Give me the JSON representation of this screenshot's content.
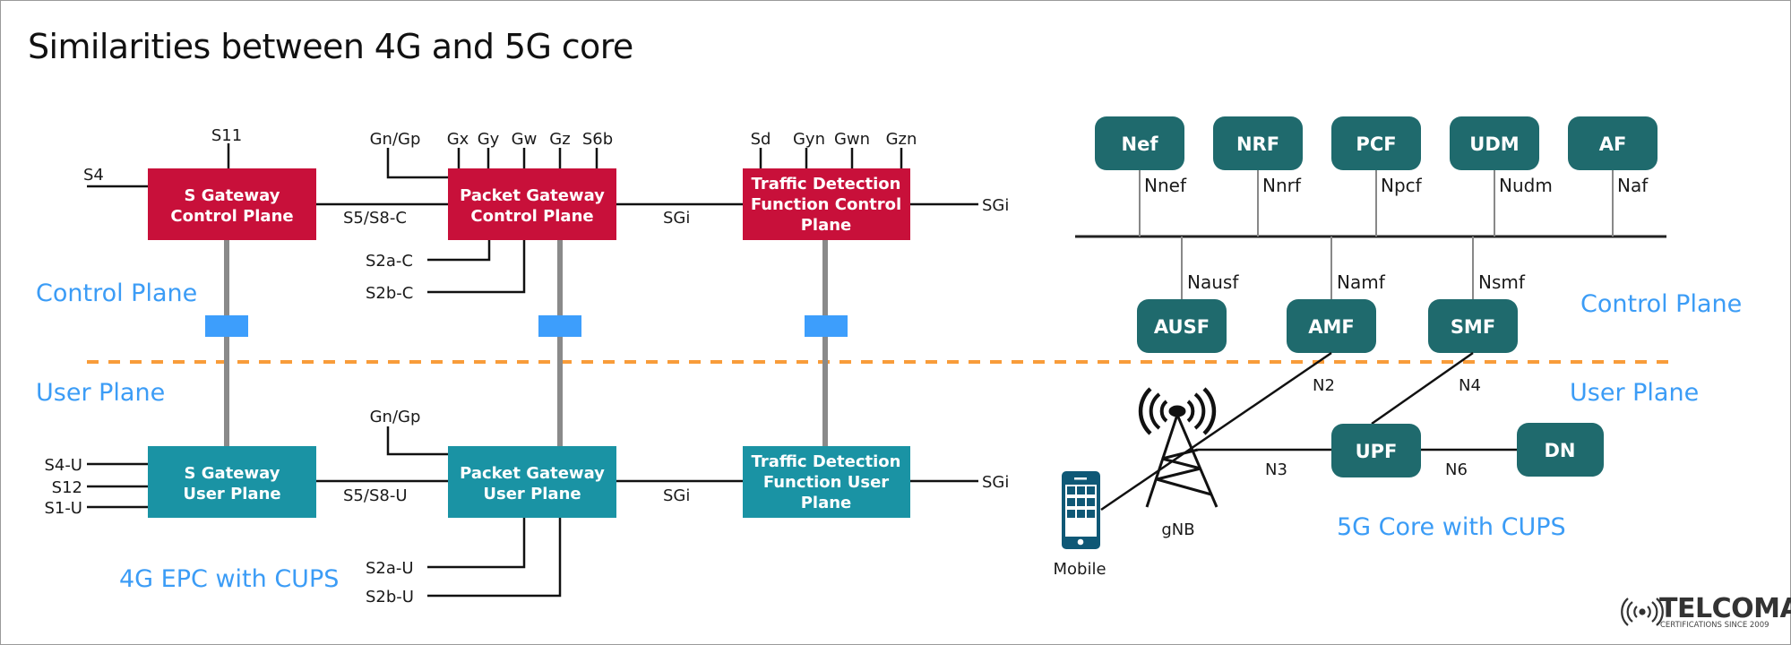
{
  "title": "Similarities between 4G and 5G core",
  "colors": {
    "control_plane_box": "#c8103a",
    "user_plane_box": "#1a93a4",
    "nf_box": "#1f6a6d",
    "plane_label": "#3b9cf6",
    "divider": "#f89c3a",
    "connector": "#3d9efc",
    "phone": "#0f5876"
  },
  "plane_labels": {
    "left_control": "Control Plane",
    "left_user": "User Plane",
    "right_control": "Control Plane",
    "right_user": "User Plane"
  },
  "epc4g": {
    "caption": "4G EPC with CUPS",
    "control": {
      "sgw": {
        "line1": "S Gateway",
        "line2": "Control Plane"
      },
      "pgw": {
        "line1": "Packet Gateway",
        "line2": "Control Plane"
      },
      "tdf": {
        "line1": "Traffic Detection",
        "line2": "Function Control",
        "line3": "Plane"
      }
    },
    "user": {
      "sgw": {
        "line1": "S Gateway",
        "line2": "User Plane"
      },
      "pgw": {
        "line1": "Packet Gateway",
        "line2": "User Plane"
      },
      "tdf": {
        "line1": "Traffic Detection",
        "line2": "Function User",
        "line3": "Plane"
      }
    },
    "interfaces": {
      "s11": "S11",
      "s4": "S4",
      "s5s8c": "S5/S8-C",
      "gngp_c": "Gn/Gp",
      "gx": "Gx",
      "gy": "Gy",
      "gw": "Gw",
      "gz": "Gz",
      "s6b": "S6b",
      "s2ac": "S2a-C",
      "s2bc": "S2b-C",
      "sgi_c1": "SGi",
      "sd": "Sd",
      "gyn": "Gyn",
      "gwn": "Gwn",
      "gzn": "Gzn",
      "sgi_c2": "SGi",
      "s4u": "S4-U",
      "s12": "S12",
      "s1u": "S1-U",
      "s5s8u": "S5/S8-U",
      "gngp_u": "Gn/Gp",
      "s2au": "S2a-U",
      "s2bu": "S2b-U",
      "sgi_u1": "SGi",
      "sgi_u2": "SGi"
    }
  },
  "core5g": {
    "caption": "5G Core with CUPS",
    "top_nfs": [
      {
        "name": "Nef",
        "iface": "Nnef"
      },
      {
        "name": "NRF",
        "iface": "Nnrf"
      },
      {
        "name": "PCF",
        "iface": "Npcf"
      },
      {
        "name": "UDM",
        "iface": "Nudm"
      },
      {
        "name": "AF",
        "iface": "Naf"
      }
    ],
    "bottom_nfs": [
      {
        "name": "AUSF",
        "iface": "Nausf"
      },
      {
        "name": "AMF",
        "iface": "Namf"
      },
      {
        "name": "SMF",
        "iface": "Nsmf"
      }
    ],
    "upf": "UPF",
    "dn": "DN",
    "gnb": "gNB",
    "mobile": "Mobile",
    "links": {
      "n2": "N2",
      "n3": "N3",
      "n4": "N4",
      "n6": "N6"
    }
  },
  "logo": {
    "brand": "TELCOMA",
    "tagline": "CERTIFICATIONS SINCE 2009"
  }
}
